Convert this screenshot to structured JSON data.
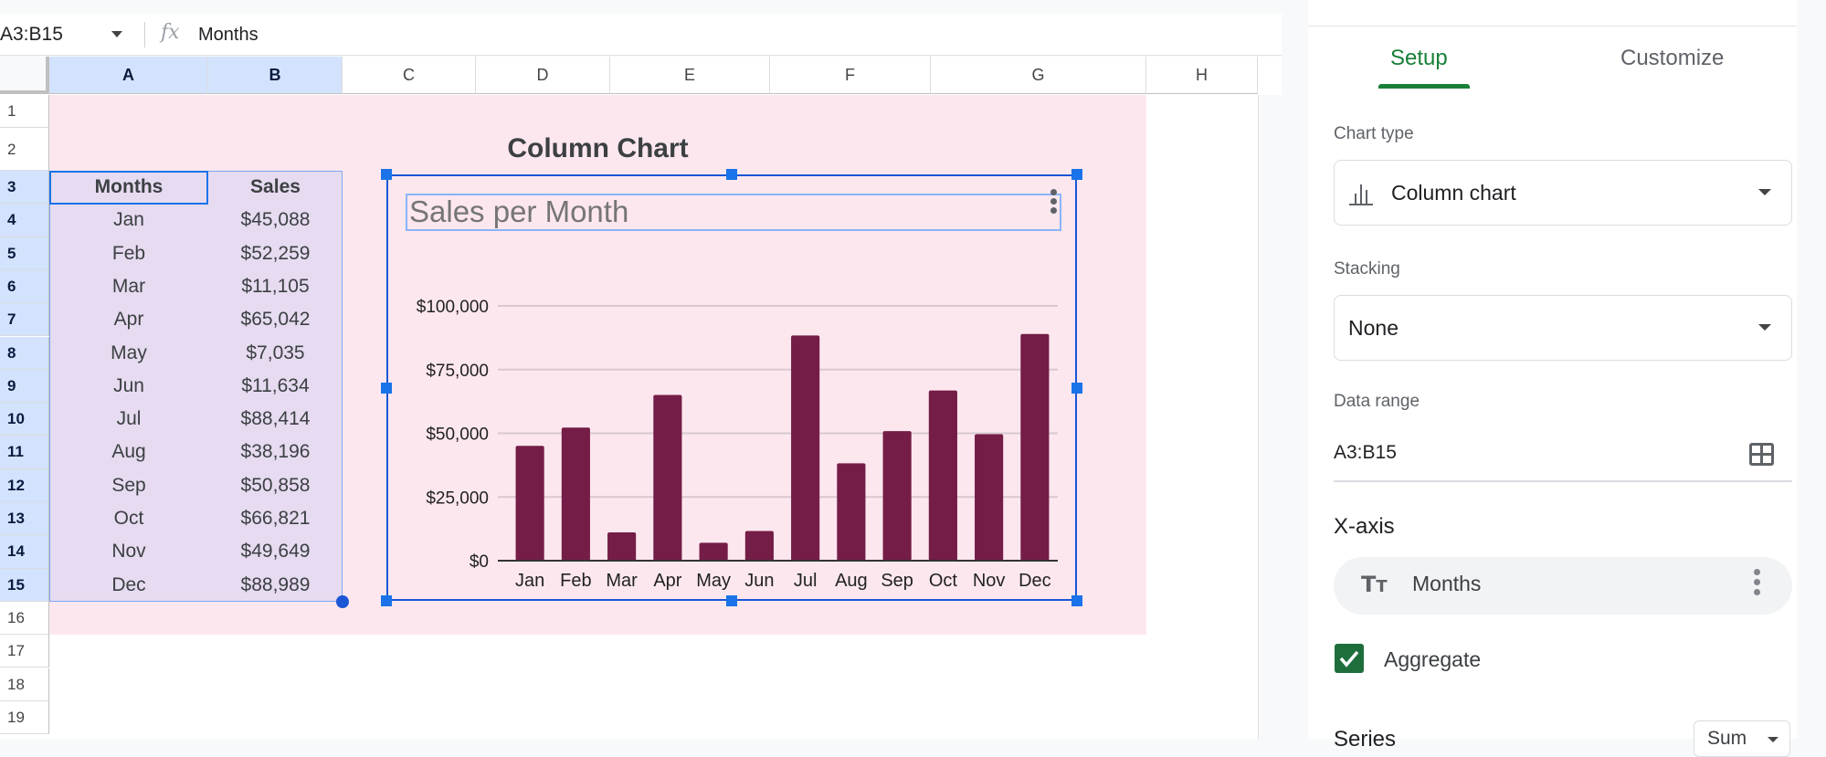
{
  "formula_bar": {
    "name_box": "A3:B15",
    "fx_icon": "function-icon",
    "value": "Months"
  },
  "grid": {
    "columns": [
      "A",
      "B",
      "C",
      "D",
      "E",
      "F",
      "G",
      "H"
    ],
    "selected_columns": [
      "A",
      "B"
    ],
    "rows": [
      "1",
      "2",
      "3",
      "4",
      "5",
      "6",
      "7",
      "8",
      "9",
      "10",
      "11",
      "12",
      "13",
      "14",
      "15",
      "16",
      "17",
      "18",
      "19"
    ],
    "selected_rows": [
      "3",
      "4",
      "5",
      "6",
      "7",
      "8",
      "9",
      "10",
      "11",
      "12",
      "13",
      "14",
      "15"
    ],
    "sheet_title": "Column Chart",
    "table": {
      "headers": [
        "Months",
        "Sales"
      ],
      "rows": [
        [
          "Jan",
          "$45,088"
        ],
        [
          "Feb",
          "$52,259"
        ],
        [
          "Mar",
          "$11,105"
        ],
        [
          "Apr",
          "$65,042"
        ],
        [
          "May",
          "$7,035"
        ],
        [
          "Jun",
          "$11,634"
        ],
        [
          "Jul",
          "$88,414"
        ],
        [
          "Aug",
          "$38,196"
        ],
        [
          "Sep",
          "$50,858"
        ],
        [
          "Oct",
          "$66,821"
        ],
        [
          "Nov",
          "$49,649"
        ],
        [
          "Dec",
          "$88,989"
        ]
      ]
    },
    "colors": {
      "sheet_bg": "#fde7ef",
      "selection_bg": "#e6dbf0",
      "header_selected": "#d3e3fd",
      "selection_border": "#1a73e8"
    }
  },
  "chart_data": {
    "type": "bar",
    "title": "Sales per Month",
    "categories": [
      "Jan",
      "Feb",
      "Mar",
      "Apr",
      "May",
      "Jun",
      "Jul",
      "Aug",
      "Sep",
      "Oct",
      "Nov",
      "Dec"
    ],
    "values": [
      45088,
      52259,
      11105,
      65042,
      7035,
      11634,
      88414,
      38196,
      50858,
      66821,
      49649,
      88989
    ],
    "xlabel": "Months",
    "ylabel": "",
    "ylim": [
      0,
      100000
    ],
    "yticks": [
      0,
      25000,
      50000,
      75000,
      100000
    ],
    "ytick_labels": [
      "$0",
      "$25,000",
      "$50,000",
      "$75,000",
      "$100,000"
    ],
    "grid": true,
    "legend": "none",
    "bar_color": "#741d46"
  },
  "panel": {
    "tabs": [
      {
        "label": "Setup",
        "active": true
      },
      {
        "label": "Customize",
        "active": false
      }
    ],
    "chart_type_label": "Chart type",
    "chart_type_value": "Column chart",
    "chart_type_icon": "column-chart-icon",
    "stacking_label": "Stacking",
    "stacking_value": "None",
    "data_range_label": "Data range",
    "data_range_value": "A3:B15",
    "data_range_icon": "grid-select-icon",
    "xaxis_heading": "X-axis",
    "xaxis_value": "Months",
    "aggregate_label": "Aggregate",
    "aggregate_checked": true,
    "series_label": "Series",
    "series_agg_value": "Sum",
    "accent_color": "#188038"
  }
}
